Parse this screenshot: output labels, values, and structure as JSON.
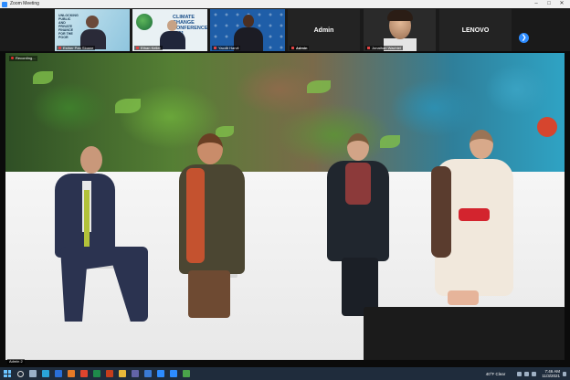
{
  "window": {
    "title": "Zoom Meeting"
  },
  "gallery": {
    "tiles": [
      {
        "type": "video",
        "name": "Esther Pan Sloane",
        "slide_text": "UNLOCKING PUBLIC AND PRIVATE FINANCE FOR THE POOR"
      },
      {
        "type": "video",
        "name": "Ethan Keller",
        "slide_text": "CLIMATE CHANGE CONFERENCE 2021"
      },
      {
        "type": "video",
        "name": "Yacob Harvil"
      },
      {
        "type": "text",
        "label": "Admin",
        "name": "Admin"
      },
      {
        "type": "video",
        "name": "Jonathan Wachtel"
      },
      {
        "type": "text",
        "label": "LENOVO",
        "name": "LENOVO"
      }
    ],
    "next_icon": "chevron-right-icon"
  },
  "main_video": {
    "recording_label": "Recording...",
    "self_label": "Admin 2"
  },
  "taskbar": {
    "weather": "40°F  Clear",
    "time": "7:46 AM",
    "date": "11/3/2021"
  },
  "colors": {
    "zoom_blue": "#2d8cff",
    "record_red": "#e53030",
    "taskbar": "#1f2c3c"
  }
}
